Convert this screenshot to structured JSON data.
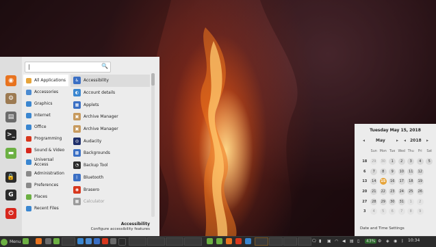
{
  "search": {
    "value": "|",
    "icon": "search-icon"
  },
  "favorites": [
    {
      "name": "firefox-icon",
      "color": "#e8731f",
      "glyph": "◉"
    },
    {
      "name": "settings-icon",
      "color": "#9c7a52",
      "glyph": "⚙"
    },
    {
      "name": "system-icon",
      "color": "#6b6b6b",
      "glyph": "▤"
    },
    {
      "name": "terminal-icon",
      "color": "#2b2b2b",
      "glyph": ">_"
    },
    {
      "name": "files-icon",
      "color": "#6cb043",
      "glyph": "▬"
    },
    {
      "name": "lock-icon",
      "color": "#2b2b2b",
      "glyph": "🔒"
    },
    {
      "name": "logout-icon",
      "color": "#2b2b2b",
      "glyph": "G"
    },
    {
      "name": "power-icon",
      "color": "#d7271d",
      "glyph": "⏻"
    }
  ],
  "categories": [
    {
      "label": "All Applications",
      "color": "#e6a43a",
      "selected": true
    },
    {
      "label": "Accessories",
      "color": "#4b8bd1"
    },
    {
      "label": "Graphics",
      "color": "#3a86d0"
    },
    {
      "label": "Internet",
      "color": "#3a86d0"
    },
    {
      "label": "Office",
      "color": "#3a86d0"
    },
    {
      "label": "Programming",
      "color": "#d7371d"
    },
    {
      "label": "Sound & Video",
      "color": "#d7271d"
    },
    {
      "label": "Universal Access",
      "color": "#3a86d0"
    },
    {
      "label": "Administration",
      "color": "#8a8a8a"
    },
    {
      "label": "Preferences",
      "color": "#8a8a8a"
    },
    {
      "label": "Places",
      "color": "#6cb043"
    },
    {
      "label": "Recent Files",
      "color": "#3a86d0"
    }
  ],
  "apps": [
    {
      "label": "Accessibility",
      "color": "#3a6fc4",
      "glyph": "♿",
      "highlight": true
    },
    {
      "label": "Account details",
      "color": "#3a86d0",
      "glyph": "◐"
    },
    {
      "label": "Applets",
      "color": "#3a6fc4",
      "glyph": "▦"
    },
    {
      "label": "Archive Manager",
      "color": "#c79a5e",
      "glyph": "▣"
    },
    {
      "label": "Archive Manager",
      "color": "#c79a5e",
      "glyph": "▣"
    },
    {
      "label": "Audacity",
      "color": "#1f2f6a",
      "glyph": "◎"
    },
    {
      "label": "Backgrounds",
      "color": "#3a6fc4",
      "glyph": "▩"
    },
    {
      "label": "Backup Tool",
      "color": "#2b2b2b",
      "glyph": "◔"
    },
    {
      "label": "Bluetooth",
      "color": "#3a6fc4",
      "glyph": "ᛒ"
    },
    {
      "label": "Brasero",
      "color": "#d7371d",
      "glyph": "◉"
    },
    {
      "label": "Calculator",
      "color": "#9a9a9a",
      "glyph": "▦",
      "dim": true
    }
  ],
  "description": {
    "title": "Accessibility",
    "text": "Configure accessibility features"
  },
  "calendar": {
    "date_title": "Tuesday May 15, 2018",
    "month": "May",
    "year": "2018",
    "weekdays": [
      "Sun",
      "Mon",
      "Tue",
      "Wed",
      "Thu",
      "Fri",
      "Sat"
    ],
    "weeks": [
      {
        "wk": "18",
        "days": [
          "29",
          "30",
          "1",
          "2",
          "3",
          "4",
          "5"
        ],
        "other": [
          0,
          1
        ]
      },
      {
        "wk": "6",
        "days": [
          "7",
          "8",
          "9",
          "10",
          "11",
          "12",
          ""
        ],
        "other": []
      },
      {
        "wk": "13",
        "days": [
          "14",
          "15",
          "16",
          "17",
          "18",
          "19",
          ""
        ],
        "other": [],
        "today": 1
      },
      {
        "wk": "20",
        "days": [
          "21",
          "22",
          "23",
          "24",
          "25",
          "26",
          ""
        ],
        "other": []
      },
      {
        "wk": "27",
        "days": [
          "28",
          "29",
          "30",
          "31",
          "1",
          "2",
          ""
        ],
        "other": [
          4,
          5
        ]
      },
      {
        "wk": "3",
        "days": [
          "4",
          "5",
          "6",
          "7",
          "8",
          "9",
          ""
        ],
        "other": [
          0,
          1,
          2,
          3,
          4,
          5
        ]
      }
    ],
    "settings_label": "Date and Time Settings"
  },
  "taskbar": {
    "menu_label": "Menu",
    "clock": "10:34",
    "battery": "43%"
  }
}
